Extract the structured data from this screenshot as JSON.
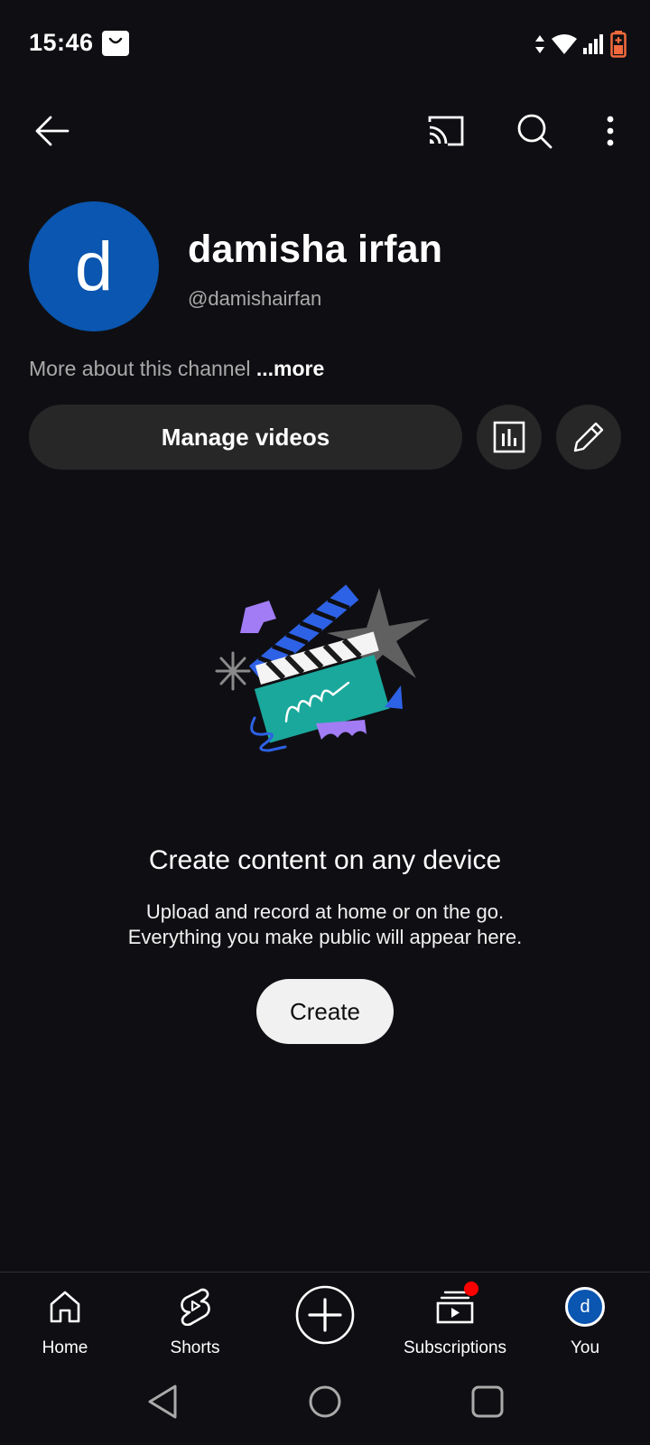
{
  "status": {
    "time": "15:46"
  },
  "channel": {
    "avatar_letter": "d",
    "name": "damisha irfan",
    "handle": "@damishairfan",
    "about_text": "More about this channel ",
    "about_more": "...more",
    "manage_label": "Manage videos"
  },
  "empty_state": {
    "title": "Create content on any device",
    "line1": "Upload and record at home or on the go.",
    "line2": "Everything you make public will appear here.",
    "create_label": "Create"
  },
  "bottom_nav": {
    "home": "Home",
    "shorts": "Shorts",
    "subscriptions": "Subscriptions",
    "you": "You",
    "you_avatar_letter": "d"
  },
  "icons": {
    "back": "arrow-back-icon",
    "cast": "cast-icon",
    "search": "search-icon",
    "more": "more-vert-icon",
    "analytics": "analytics-icon",
    "edit": "pencil-icon"
  },
  "colors": {
    "background": "#0f0f13",
    "avatar": "#0a56b0",
    "button": "#272727",
    "notification": "#ff0000"
  }
}
